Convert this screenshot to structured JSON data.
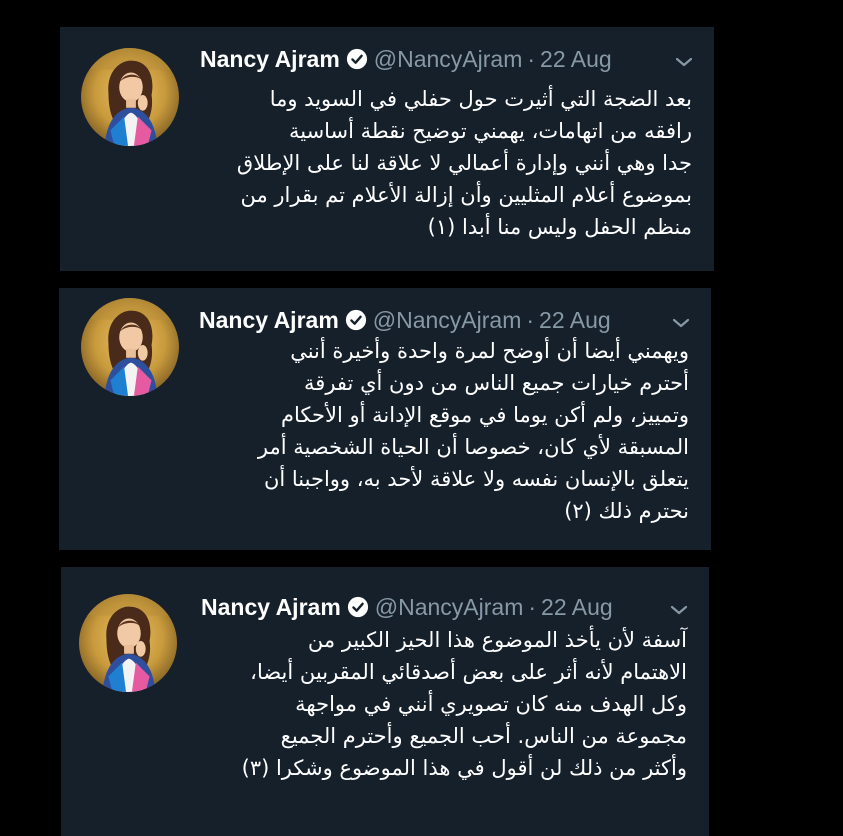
{
  "colors": {
    "page_background": "#000000",
    "tweet_background": "#15202b",
    "name_text": "#ffffff",
    "meta_text": "#8899a6",
    "body_text": "#ffffff",
    "verified_badge": "#ffffff"
  },
  "icons": {
    "verified": "verified-badge-icon",
    "more": "chevron-down-icon",
    "avatar": "profile-avatar"
  },
  "tweets": [
    {
      "name": "Nancy Ajram",
      "handle": "@NancyAjram",
      "separator": "·",
      "date": "22 Aug",
      "lines": [
        "بعد الضجة التي أثيرت حول حفلي في السويد وما",
        "رافقه من اتهامات، يهمني توضيح نقطة أساسية",
        "جدا وهي أنني وإدارة أعمالي لا علاقة لنا على الإطلاق",
        "بموضوع أعلام المثليين وأن إزالة الأعلام تم بقرار من",
        "منظم الحفل وليس منا أبدا (١)"
      ]
    },
    {
      "name": "Nancy Ajram",
      "handle": "@NancyAjram",
      "separator": "·",
      "date": "22 Aug",
      "lines": [
        "ويهمني أيضا أن أوضح لمرة واحدة وأخيرة أنني",
        "أحترم خيارات جميع الناس من دون أي تفرقة",
        "وتمييز، ولم أكن يوما في موقع الإدانة أو الأحكام",
        "المسبقة لأي كان، خصوصا أن الحياة الشخصية أمر",
        "يتعلق بالإنسان نفسه ولا علاقة لأحد به، وواجبنا أن",
        "نحترم ذلك (٢)"
      ]
    },
    {
      "name": "Nancy Ajram",
      "handle": "@NancyAjram",
      "separator": "·",
      "date": "22 Aug",
      "lines": [
        "آسفة لأن يأخذ الموضوع هذا الحيز الكبير من",
        "الاهتمام لأنه أثر على بعض أصدقائي المقربين أيضا،",
        "وكل الهدف منه كان تصويري أنني في مواجهة",
        "مجموعة من الناس. أحب الجميع وأحترم الجميع",
        "وأكثر من ذلك لن أقول في هذا الموضوع وشكرا (٣)"
      ]
    }
  ]
}
